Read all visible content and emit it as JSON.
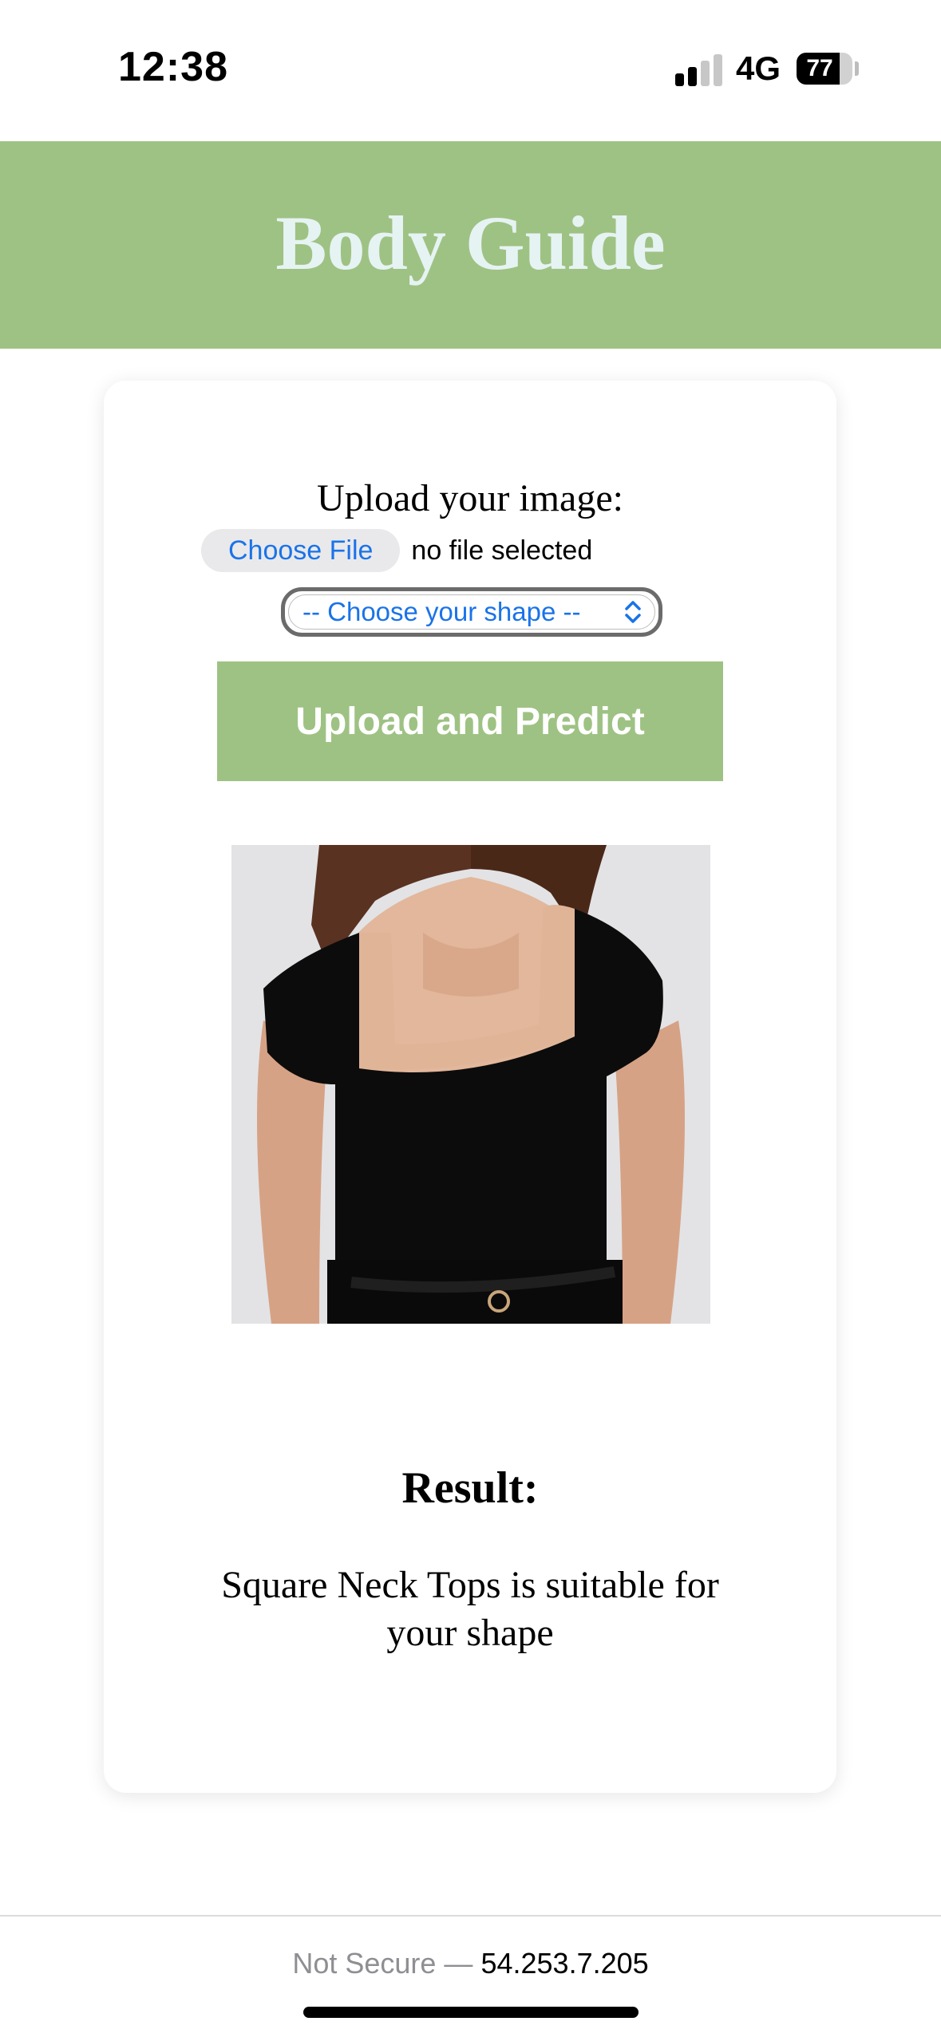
{
  "status_bar": {
    "time": "12:38",
    "network": "4G",
    "battery_level": "77",
    "battery_fraction": 0.77,
    "signal_bars_active": 2,
    "signal_bars_total": 4
  },
  "header": {
    "title": "Body Guide",
    "background_color": "#9ec283"
  },
  "form": {
    "upload_label": "Upload your image:",
    "choose_file_label": "Choose File",
    "file_status": "no file selected",
    "shape_select_value": "-- Choose your shape --",
    "submit_label": "Upload and Predict"
  },
  "preview": {
    "image_description_icon": "black-square-neck-top-photo"
  },
  "result": {
    "heading": "Result:",
    "text": "Square Neck Tops is suitable for your shape"
  },
  "browser": {
    "security_label": "Not Secure —",
    "host": "54.253.7.205"
  },
  "colors": {
    "accent": "#9ec283",
    "link_blue": "#1a73e8",
    "title_text": "#e6f3f3"
  }
}
